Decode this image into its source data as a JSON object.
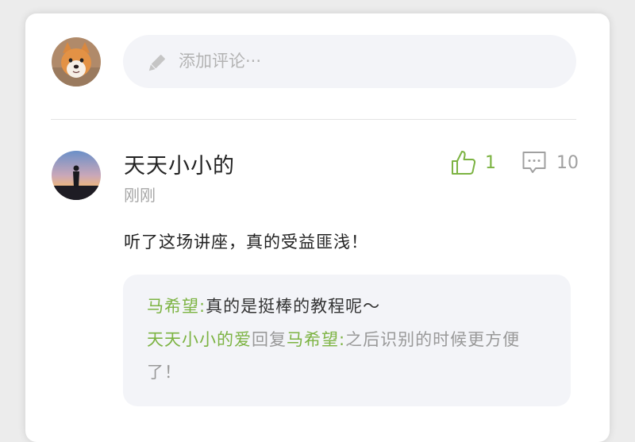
{
  "composer": {
    "placeholder": "添加评论···",
    "icon": "pencil-icon"
  },
  "comment": {
    "username": "天天小小的",
    "time": "刚刚",
    "likes": "1",
    "replies": "10",
    "text": "听了这场讲座，真的受益匪浅！",
    "reply_list": [
      {
        "author": "马希望:",
        "text": "真的是挺棒的教程呢～"
      },
      {
        "author": "天天小小的爱",
        "action": "回复",
        "target": "马希望:",
        "text": "之后识别的时候更方便了！"
      }
    ]
  },
  "colors": {
    "accent_green": "#7cb342",
    "muted_grey": "#a6a6a6",
    "reply_background": "#f3f4f8"
  }
}
